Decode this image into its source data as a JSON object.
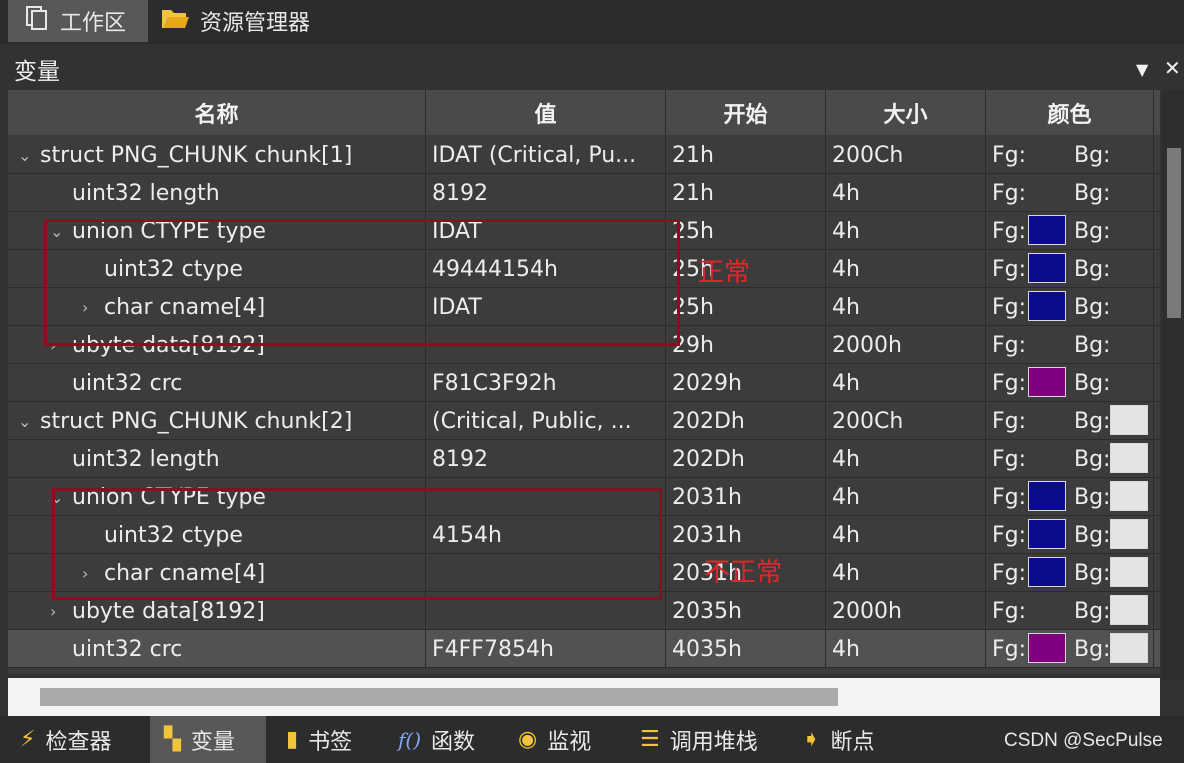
{
  "top_tabs": [
    {
      "label": "工作区",
      "icon": "workspace-icon"
    },
    {
      "label": "资源管理器",
      "icon": "folder-icon"
    }
  ],
  "panel": {
    "title": "变量",
    "dropdown_glyph": "▼",
    "close_glyph": "✕"
  },
  "table": {
    "columns": [
      "名称",
      "值",
      "开始",
      "大小",
      "颜色"
    ],
    "rows": [
      {
        "chev": "⌄",
        "name": "struct PNG_CHUNK chunk[1]",
        "value": "IDAT  (Critical, Pu...",
        "start": "21h",
        "size": "200Ch",
        "fg": "Fg:",
        "bg": "Bg:"
      },
      {
        "chev": "",
        "name": "uint32 length",
        "value": "8192",
        "start": "21h",
        "size": "4h",
        "fg": "Fg:",
        "bg": "Bg:"
      },
      {
        "chev": "⌄",
        "name": "union CTYPE type",
        "value": "IDAT",
        "start": "25h",
        "size": "4h",
        "fg": "Fg:",
        "bg": "Bg:",
        "fg_color": "#0b0b8c"
      },
      {
        "chev": "",
        "name": "uint32 ctype",
        "value": "49444154h",
        "start": "25h",
        "size": "4h",
        "fg": "Fg:",
        "bg": "Bg:",
        "fg_color": "#0b0b8c"
      },
      {
        "chev": "›",
        "name": "char cname[4]",
        "value": "IDAT",
        "start": "25h",
        "size": "4h",
        "fg": "Fg:",
        "bg": "Bg:",
        "fg_color": "#0b0b8c"
      },
      {
        "chev": "›",
        "name": "ubyte data[8192]",
        "value": "",
        "start": "29h",
        "size": "2000h",
        "fg": "Fg:",
        "bg": "Bg:"
      },
      {
        "chev": "",
        "name": "uint32 crc",
        "value": "F81C3F92h",
        "start": "2029h",
        "size": "4h",
        "fg": "Fg:",
        "bg": "Bg:",
        "fg_color": "#800080"
      },
      {
        "chev": "⌄",
        "name": "struct PNG_CHUNK chunk[2]",
        "value": "  (Critical, Public, ...",
        "start": "202Dh",
        "size": "200Ch",
        "fg": "Fg:",
        "bg": "Bg:",
        "bg_color": "#e4e4e4"
      },
      {
        "chev": "",
        "name": "uint32 length",
        "value": "8192",
        "start": "202Dh",
        "size": "4h",
        "fg": "Fg:",
        "bg": "Bg:",
        "bg_color": "#e4e4e4"
      },
      {
        "chev": "⌄",
        "name": "union CTYPE type",
        "value": "",
        "start": "2031h",
        "size": "4h",
        "fg": "Fg:",
        "bg": "Bg:",
        "fg_color": "#0b0b8c",
        "bg_color": "#e4e4e4"
      },
      {
        "chev": "",
        "name": "uint32 ctype",
        "value": "4154h",
        "start": "2031h",
        "size": "4h",
        "fg": "Fg:",
        "bg": "Bg:",
        "fg_color": "#0b0b8c",
        "bg_color": "#e4e4e4"
      },
      {
        "chev": "›",
        "name": "char cname[4]",
        "value": "",
        "start": "2031h",
        "size": "4h",
        "fg": "Fg:",
        "bg": "Bg:",
        "fg_color": "#0b0b8c",
        "bg_color": "#e4e4e4"
      },
      {
        "chev": "›",
        "name": "ubyte data[8192]",
        "value": "",
        "start": "2035h",
        "size": "2000h",
        "fg": "Fg:",
        "bg": "Bg:",
        "bg_color": "#e4e4e4"
      },
      {
        "chev": "",
        "name": "uint32 crc",
        "value": "F4FF7854h",
        "start": "4035h",
        "size": "4h",
        "fg": "Fg:",
        "bg": "Bg:",
        "fg_color": "#800080",
        "bg_color": "#e4e4e4",
        "highlight": true
      }
    ]
  },
  "annotations": [
    {
      "text": "正常",
      "color": "#e4262a"
    },
    {
      "text": "不正常",
      "color": "#e4262a"
    }
  ],
  "bottom_tabs": [
    {
      "label": "检查器",
      "icon": "lightning-icon",
      "glyph": "⚡"
    },
    {
      "label": "变量",
      "icon": "variables-icon",
      "glyph": "▚",
      "active": true
    },
    {
      "label": "书签",
      "icon": "bookmark-icon",
      "glyph": "▮"
    },
    {
      "label": "函数",
      "icon": "function-icon",
      "glyph": "f()"
    },
    {
      "label": "监视",
      "icon": "eye-icon",
      "glyph": "◉"
    },
    {
      "label": "调用堆栈",
      "icon": "callstack-icon",
      "glyph": "☰"
    },
    {
      "label": "断点",
      "icon": "breakpoint-icon",
      "glyph": "➧"
    }
  ],
  "watermark": "CSDN @SecPulse"
}
